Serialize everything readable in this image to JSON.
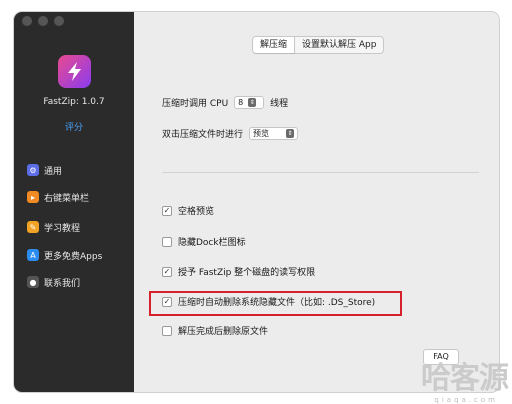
{
  "app": {
    "name": "FastZip: 1.0.7",
    "rate_label": "评分"
  },
  "sidebar": {
    "items": [
      {
        "label": "通用",
        "icon": "gear-icon",
        "icon_color": "#5b6ee8",
        "icon_char": "⚙"
      },
      {
        "label": "右键菜单栏",
        "icon": "cursor-icon",
        "icon_color": "#f08a24",
        "icon_char": "▸"
      },
      {
        "label": "学习教程",
        "icon": "book-icon",
        "icon_color": "#f0a324",
        "icon_char": "✎"
      },
      {
        "label": "更多免费Apps",
        "icon": "app-store-icon",
        "icon_color": "#2b8cf0",
        "icon_char": "A"
      },
      {
        "label": "联系我们",
        "icon": "people-icon",
        "icon_color": "#555555",
        "icon_char": "●"
      }
    ]
  },
  "tabs": {
    "active": "解压缩",
    "other": "设置默认解压 App"
  },
  "settings": {
    "cpu_label_pre": "压缩时调用 CPU",
    "cpu_value": "8",
    "cpu_label_post": "线程",
    "double_click_label": "双击压缩文件时进行",
    "double_click_value": "预览"
  },
  "checkboxes": [
    {
      "label": "空格预览",
      "checked": true
    },
    {
      "label": "隐藏Dock栏图标",
      "checked": false
    },
    {
      "label": "授予 FastZip 整个磁盘的读写权限",
      "checked": true
    },
    {
      "label": "压缩时自动删除系统隐藏文件（比如: .DS_Store)",
      "checked": true
    },
    {
      "label": "解压完成后删除原文件",
      "checked": false
    }
  ],
  "faq_label": "FAQ",
  "watermark": {
    "cn": "哈客源",
    "en": "qiaqa.com"
  },
  "colors": {
    "accent": "#4aa3ff",
    "highlight": "#d6202a"
  }
}
